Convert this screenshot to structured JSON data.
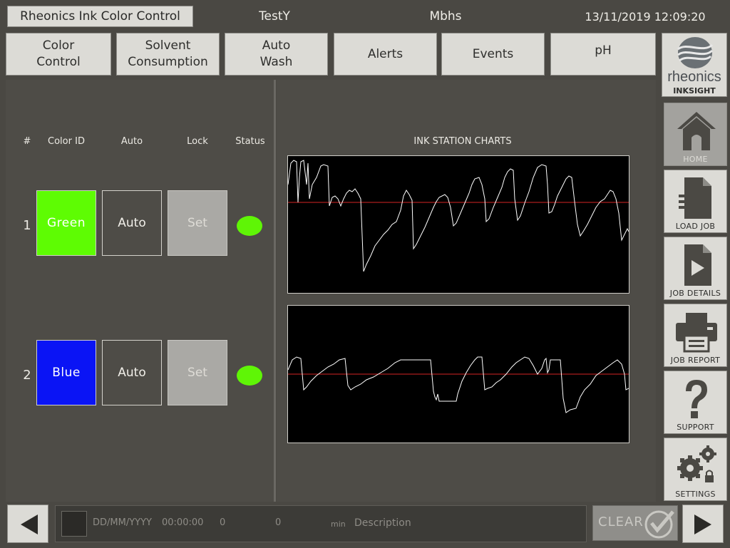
{
  "header": {
    "app_title": "Rheonics Ink Color Control",
    "job_name": "TestY",
    "user": "Mbhs",
    "datetime": "13/11/2019 12:09:20"
  },
  "tabs": [
    {
      "label_line1": "Color",
      "label_line2": "Control"
    },
    {
      "label_line1": "Solvent",
      "label_line2": "Consumption"
    },
    {
      "label_line1": "Auto",
      "label_line2": "Wash"
    },
    {
      "label_line1": "Alerts",
      "label_line2": ""
    },
    {
      "label_line1": "Events",
      "label_line2": ""
    },
    {
      "label_line1": "pH",
      "label_line2": ""
    }
  ],
  "table": {
    "columns": [
      "#",
      "Color ID",
      "Auto",
      "Lock",
      "Status"
    ],
    "rows": [
      {
        "num": "1",
        "color_id": "Green",
        "color": "#5efc03",
        "auto": "Auto",
        "lock": "Set",
        "status_color": "#5ff506"
      },
      {
        "num": "2",
        "color_id": "Blue",
        "color": "#0a14f5",
        "auto": "Auto",
        "lock": "Set",
        "status_color": "#5ff506"
      }
    ]
  },
  "charts": {
    "title": "INK STATION CHARTS",
    "line_color": "#ffffff",
    "reference_color": "#d42525"
  },
  "sidebar": {
    "logo_text": "rheonics",
    "logo_subtext": "INKSIGHT",
    "items": [
      {
        "label": "HOME",
        "icon": "home-icon"
      },
      {
        "label": "LOAD JOB",
        "icon": "document-icon"
      },
      {
        "label": "JOB DETAILS",
        "icon": "play-document-icon"
      },
      {
        "label": "JOB REPORT",
        "icon": "printer-icon"
      },
      {
        "label": "SUPPORT",
        "icon": "question-icon"
      },
      {
        "label": "SETTINGS",
        "icon": "gears-lock-icon"
      }
    ]
  },
  "footer": {
    "date": "DD/MM/YYYY",
    "time": "00:00:00",
    "value1": "0",
    "value2": "0",
    "unit": "min",
    "description": "Description",
    "clear_label": "CLEAR"
  }
}
